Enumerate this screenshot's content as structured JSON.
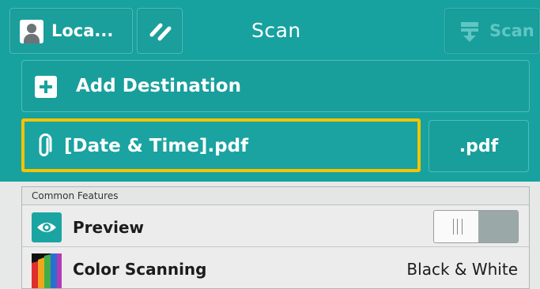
{
  "header": {
    "user_label": "Loca...",
    "title": "Scan",
    "scan_button_label": "Scan"
  },
  "destination": {
    "add_label": "Add Destination"
  },
  "file": {
    "name": "[Date & Time].pdf",
    "format": ".pdf"
  },
  "features": {
    "section_title": "Common Features",
    "preview_label": "Preview",
    "color_label": "Color Scanning",
    "color_value": "Black & White"
  },
  "colors": {
    "accent": "#17a29f",
    "highlight": "#f5c400"
  }
}
